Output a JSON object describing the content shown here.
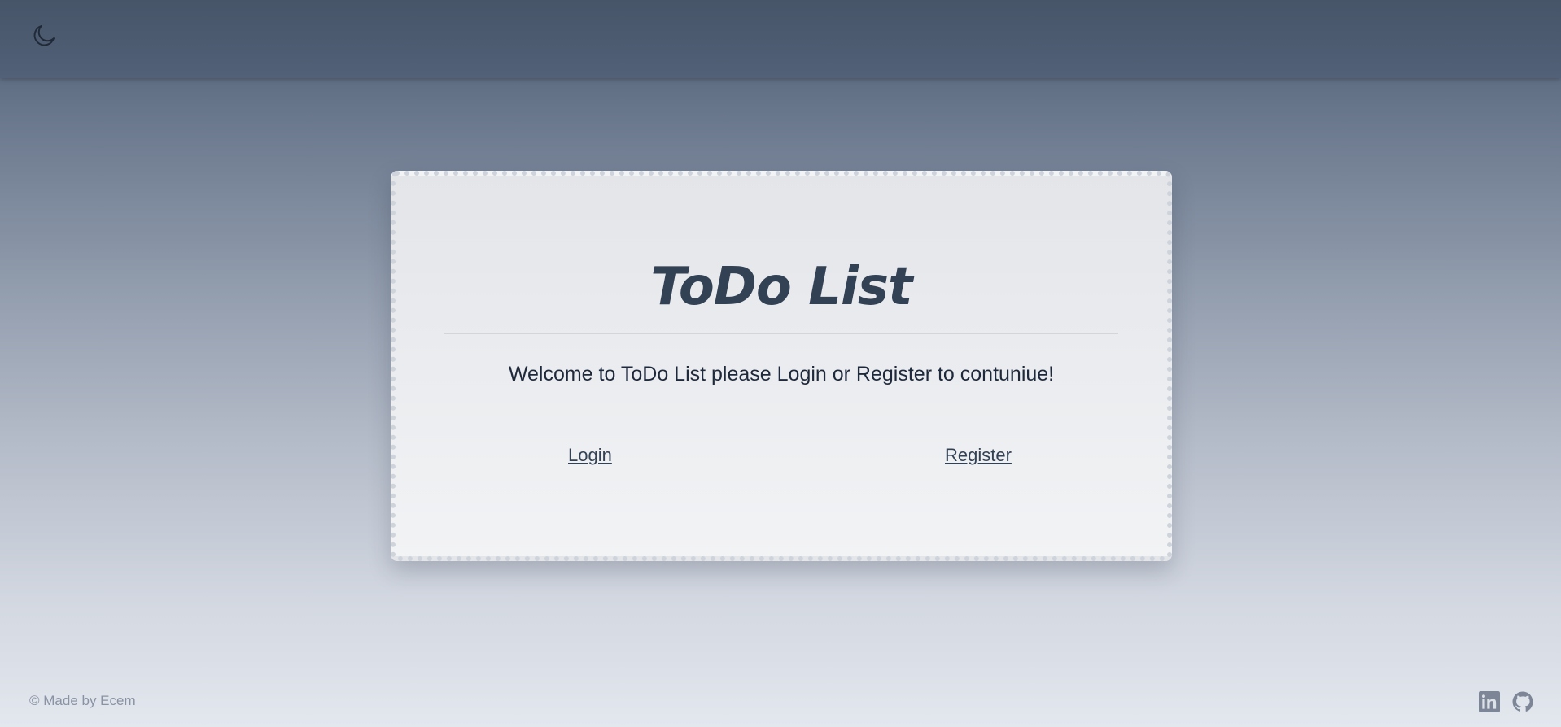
{
  "header": {
    "theme_toggle_icon": "moon-icon"
  },
  "card": {
    "title": "ToDo List",
    "welcome": "Welcome to ToDo List please Login or Register to contuniue!",
    "login_label": "Login",
    "register_label": "Register"
  },
  "footer": {
    "credit": "© Made by Ecem",
    "icons": [
      "linkedin-icon",
      "github-icon"
    ]
  },
  "colors": {
    "header_bg": "#475569",
    "title": "#334155",
    "text": "#1e293b",
    "footer_text": "#8a93a3",
    "icon": "#7c8696"
  }
}
